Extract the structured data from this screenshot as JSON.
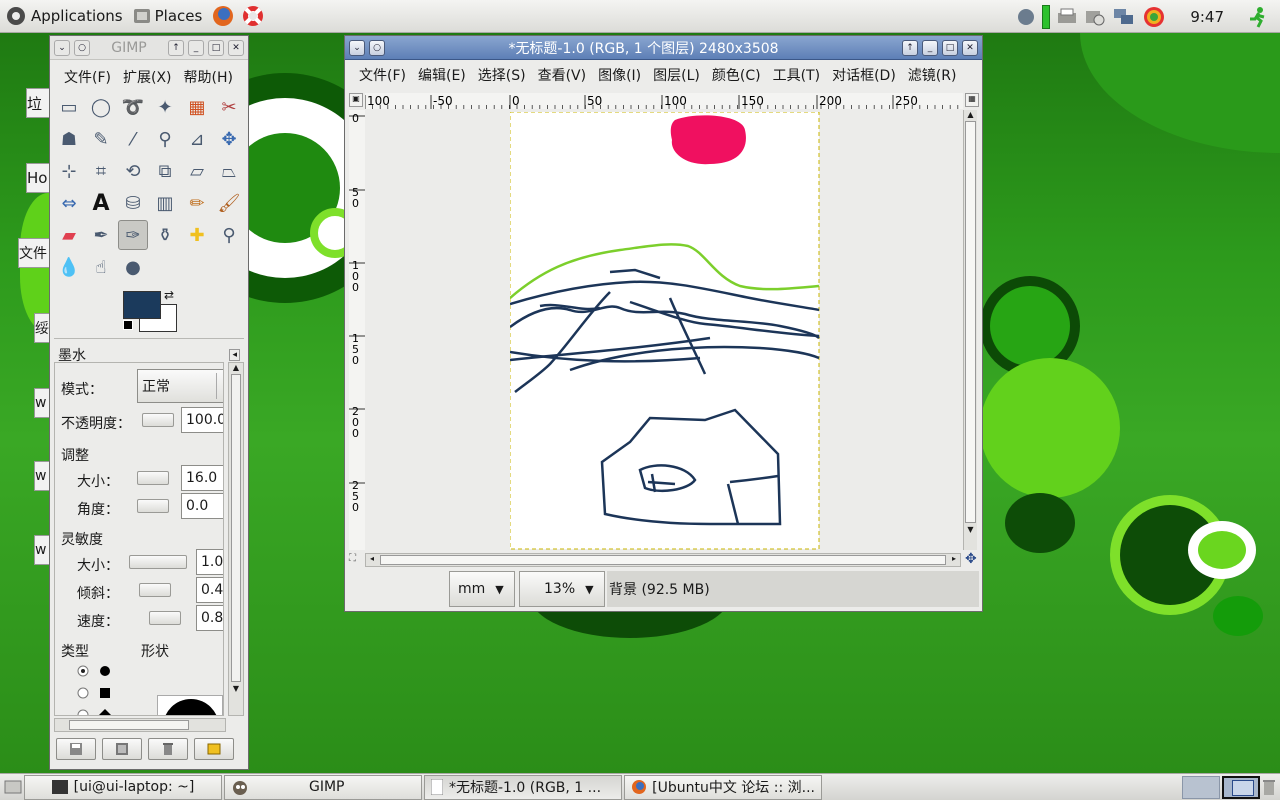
{
  "topbar": {
    "applications": "Applications",
    "places": "Places",
    "clock": "9:47"
  },
  "desktop_icons": [
    "垃",
    "Ho",
    "文件",
    "绥",
    "w",
    "w",
    "w"
  ],
  "toolbox": {
    "title": "GIMP",
    "menus": [
      "文件(F)",
      "扩展(X)",
      "帮助(H)"
    ],
    "tools": [
      "rect-select-icon",
      "ellipse-select-icon",
      "lasso-icon",
      "fuzzy-select-icon",
      "color-select-icon",
      "scissors-icon",
      "foreground-select-icon",
      "paths-icon",
      "color-picker-icon",
      "zoom-icon",
      "measure-icon",
      "move-icon",
      "align-icon",
      "crop-icon",
      "rotate-icon",
      "scale-icon",
      "shear-icon",
      "perspective-icon",
      "flip-icon",
      "text-icon",
      "bucket-fill-icon",
      "blend-icon",
      "pencil-icon",
      "paintbrush-icon",
      "eraser-icon",
      "airbrush-icon",
      "ink-icon",
      "clone-icon",
      "heal-icon",
      "perspective-clone-icon",
      "blur-icon",
      "smudge-icon",
      "dodge-burn-icon"
    ],
    "fg_color": "#1b3a5c",
    "bg_color": "#ffffff",
    "options": {
      "title": "墨水",
      "mode_label": "模式：",
      "mode_value": "正常",
      "opacity_label": "不透明度：",
      "opacity_value": "100.0",
      "adjust_label": "调整",
      "size_label": "大小：",
      "size_value": "16.0",
      "angle_label": "角度：",
      "angle_value": "0.0",
      "sensitivity_label": "灵敏度",
      "sens_size_label": "大小：",
      "sens_size_value": "1.0",
      "tilt_label": "倾斜：",
      "tilt_value": "0.4",
      "speed_label": "速度：",
      "speed_value": "0.8",
      "type_label": "类型",
      "shape_label": "形状"
    }
  },
  "image_window": {
    "title": "*无标题-1.0 (RGB, 1 个图层) 2480x3508",
    "menus": [
      "文件(F)",
      "编辑(E)",
      "选择(S)",
      "查看(V)",
      "图像(I)",
      "图层(L)",
      "颜色(C)",
      "工具(T)",
      "对话框(D)",
      "滤镜(R)"
    ],
    "ruler_h": [
      "100",
      "-50",
      "0",
      "50",
      "100",
      "150",
      "200",
      "250"
    ],
    "ruler_v": [
      "0",
      "50",
      "100",
      "150",
      "200",
      "250"
    ],
    "unit": "mm",
    "zoom": "13%",
    "status": "背景 (92.5 MB)"
  },
  "taskbar": {
    "tasks": [
      "[ui@ui-laptop: ~]",
      "GIMP",
      "*无标题-1.0 (RGB, 1 ...",
      "[Ubuntu中文 论坛 :: 浏..."
    ]
  }
}
